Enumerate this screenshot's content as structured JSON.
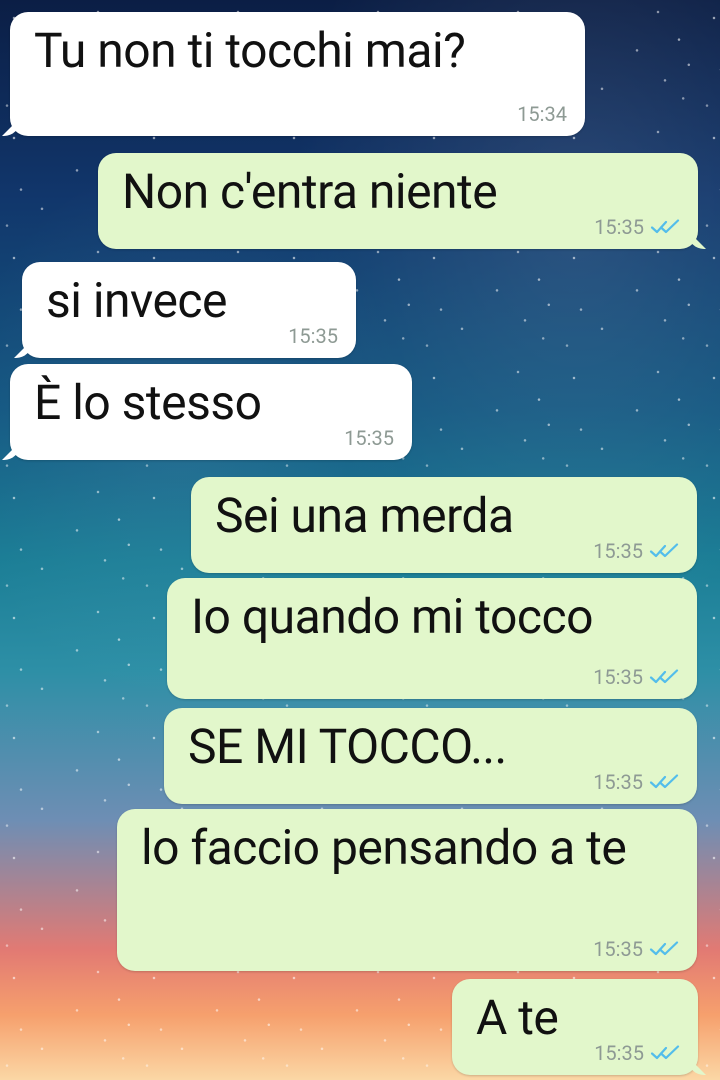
{
  "messages": [
    {
      "text": "Tu non ti tocchi mai?",
      "time": "15:34",
      "direction": "incoming",
      "read": false
    },
    {
      "text": "Non c'entra niente",
      "time": "15:35",
      "direction": "outgoing",
      "read": true
    },
    {
      "text": "si invece",
      "time": "15:35",
      "direction": "incoming",
      "read": false
    },
    {
      "text": "È lo stesso",
      "time": "15:35",
      "direction": "incoming",
      "read": false
    },
    {
      "text": "Sei una merda",
      "time": "15:35",
      "direction": "outgoing",
      "read": true
    },
    {
      "text": "Io quando mi tocco",
      "time": "15:35",
      "direction": "outgoing",
      "read": true
    },
    {
      "text": "SE MI TOCCO...",
      "time": "15:35",
      "direction": "outgoing",
      "read": true
    },
    {
      "text": "lo faccio pensando a te",
      "time": "15:35",
      "direction": "outgoing",
      "read": true
    },
    {
      "text": "A te",
      "time": "15:35",
      "direction": "outgoing",
      "read": true
    }
  ],
  "icons": {
    "read_receipt": "double-check-icon"
  },
  "colors": {
    "incoming_bubble": "#ffffff",
    "outgoing_bubble": "#e2f7cb",
    "text": "#111111",
    "timestamp": "#8e9a94",
    "read_ticks": "#53bdeb"
  }
}
